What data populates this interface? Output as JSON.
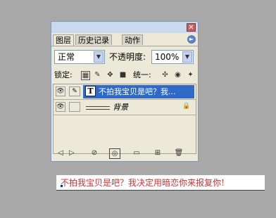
{
  "panel": {
    "close_glyph": "✕",
    "tabs": [
      {
        "label": "图层",
        "active": true
      },
      {
        "label": "历史记录",
        "active": false
      },
      {
        "label": "动作",
        "active": false
      }
    ],
    "menu_glyph": "►",
    "blend_mode": "正常",
    "opacity_label": "不透明度:",
    "opacity_value": "100%",
    "lock_label": "锁定:",
    "unify_label": "统一:",
    "layers": [
      {
        "type": "text",
        "thumb": "T",
        "name": "不拍我宝贝是吧？我...",
        "selected": true
      },
      {
        "type": "background",
        "name": "背景",
        "selected": false
      }
    ]
  },
  "canvas": {
    "text": "不拍我宝贝是吧？我决定用暗恋你来报复你!"
  },
  "colors": {
    "background": "#a8a8a8",
    "panel": "#ece9d8",
    "selection": "#3169c6",
    "canvas_text": "#cc3333"
  },
  "icons": {
    "eye": "eye-icon",
    "brush": "brush-icon",
    "lock": "lock-icon"
  }
}
